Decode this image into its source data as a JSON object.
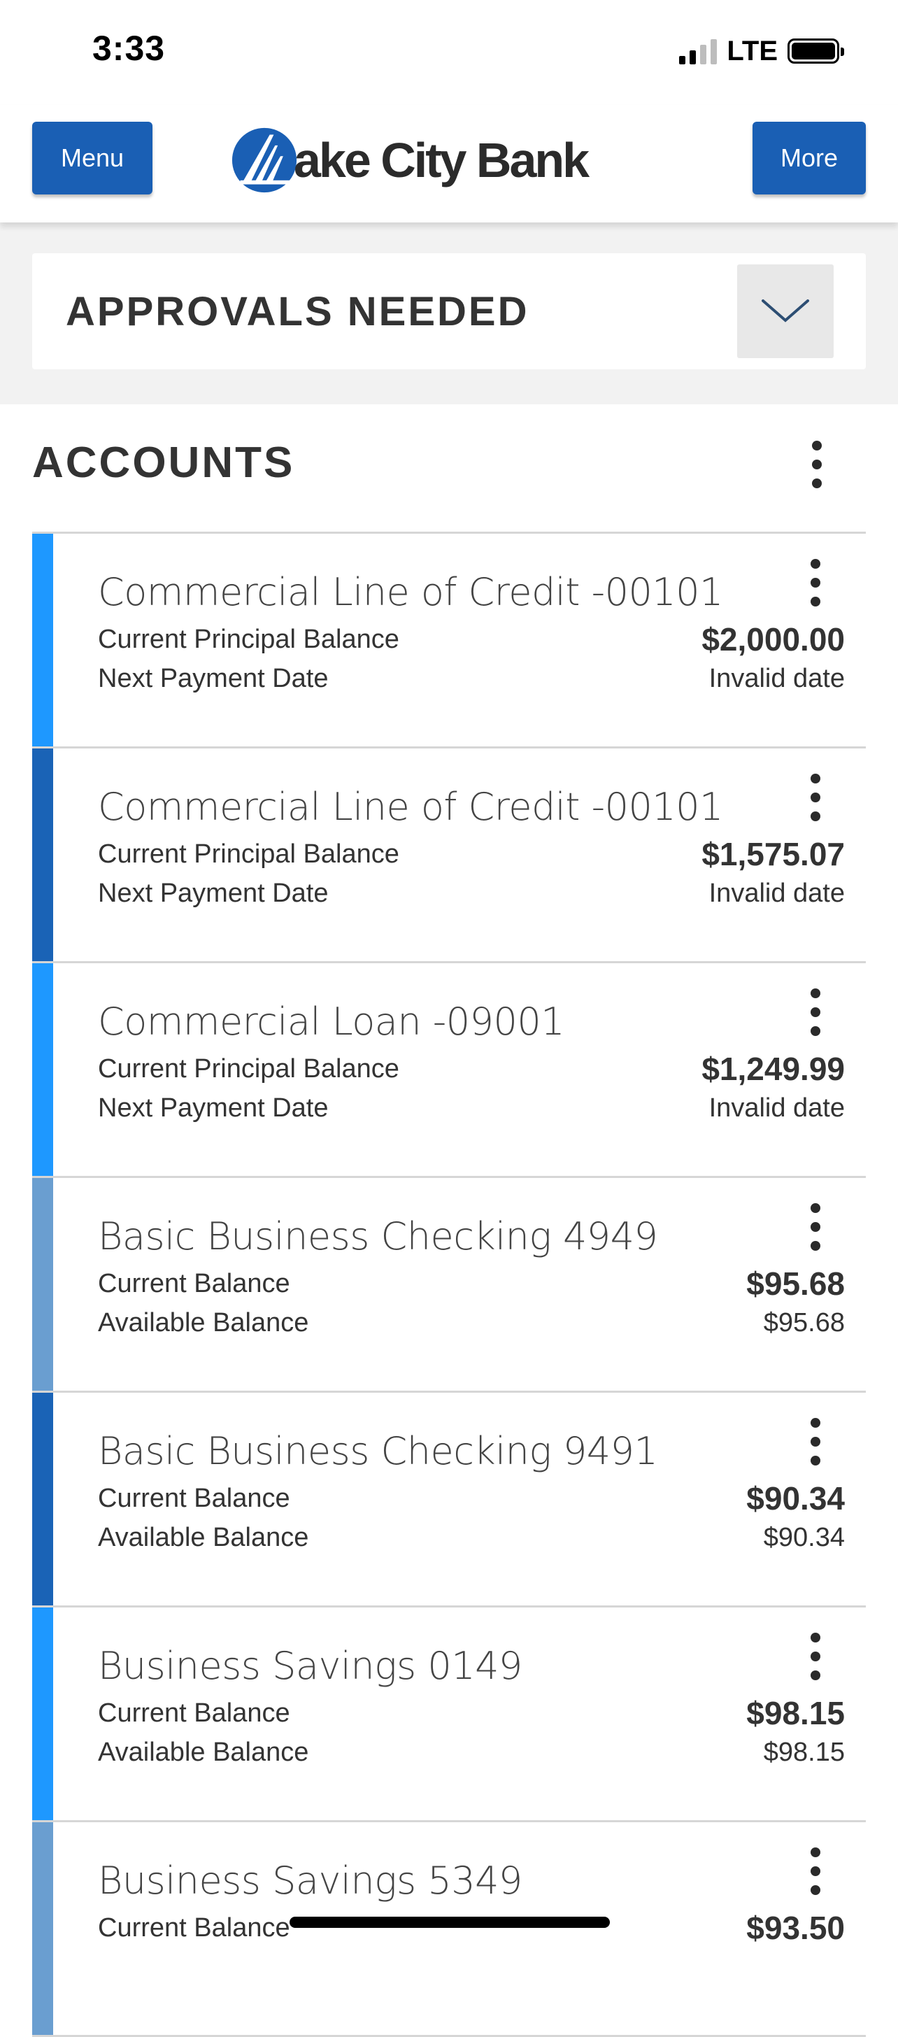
{
  "status_bar": {
    "time": "3:33",
    "network": "LTE",
    "signal_bars_active": 2,
    "signal_bars_total": 4,
    "battery_level": 1.0
  },
  "header": {
    "menu_label": "Menu",
    "more_label": "More",
    "logo_text": "ake City Bank",
    "brand_color": "#1a5fb4"
  },
  "approvals": {
    "title": "APPROVALS NEEDED",
    "toggle_icon": "chevron-down-icon"
  },
  "accounts": {
    "title": "ACCOUNTS",
    "menu_icon": "kebab-menu-icon",
    "items": [
      {
        "name": "Commercial Line of Credit -00101",
        "label1": "Current Principal Balance",
        "value1": "$2,000.00",
        "label2": "Next Payment Date",
        "value2": "Invalid date",
        "stripe_color": "#1e98ff"
      },
      {
        "name": "Commercial Line of Credit -00101",
        "label1": "Current Principal Balance",
        "value1": "$1,575.07",
        "label2": "Next Payment Date",
        "value2": "Invalid date",
        "stripe_color": "#1a63b6"
      },
      {
        "name": "Commercial Loan -09001",
        "label1": "Current Principal Balance",
        "value1": "$1,249.99",
        "label2": "Next Payment Date",
        "value2": "Invalid date",
        "stripe_color": "#1e98ff"
      },
      {
        "name": "Basic Business Checking 4949",
        "label1": "Current Balance",
        "value1": "$95.68",
        "label2": "Available Balance",
        "value2": "$95.68",
        "stripe_color": "#6a9ed0"
      },
      {
        "name": "Basic Business Checking 9491",
        "label1": "Current Balance",
        "value1": "$90.34",
        "label2": "Available Balance",
        "value2": "$90.34",
        "stripe_color": "#1a63b6"
      },
      {
        "name": "Business Savings 0149",
        "label1": "Current Balance",
        "value1": "$98.15",
        "label2": "Available Balance",
        "value2": "$98.15",
        "stripe_color": "#1e98ff"
      },
      {
        "name": "Business Savings 5349",
        "label1": "Current Balance",
        "value1": "$93.50",
        "label2": "",
        "value2": "",
        "stripe_color": "#6a9ed0"
      }
    ]
  }
}
